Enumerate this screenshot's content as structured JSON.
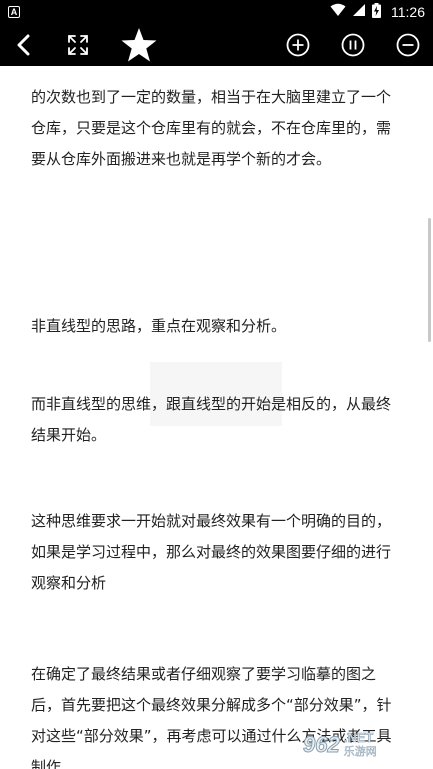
{
  "status_bar": {
    "notification_badge": "A",
    "time": "11:26",
    "icons": [
      "wifi-icon",
      "signal-icon",
      "battery-charging-icon"
    ]
  },
  "toolbar": {
    "buttons": [
      "back-arrow-icon",
      "fullscreen-icon",
      "star-icon",
      "zoom-in-icon",
      "pause-icon",
      "zoom-out-icon"
    ]
  },
  "content": {
    "paragraphs": [
      "的次数也到了一定的数量，相当于在大脑里建立了一个仓库，只要是这个仓库里有的就会，不在仓库里的，需要从仓库外面搬进来也就是再学个新的才会。",
      "非直线型的思路，重点在观察和分析。",
      "而非直线型的思维，跟直线型的开始是相反的，从最终结果开始。",
      "这种思维要求一开始就对最终效果有一个明确的目的，如果是学习过程中，那么对最终的效果图要仔细的进行观察和分析",
      "在确定了最终结果或者仔细观察了要学习临摹的图之后，首先要把这个最终效果分解成多个“部分效果”，针对这些“部分效果”，再考虑可以通过什么方法或者工具制作"
    ]
  },
  "watermark": {
    "logo": "962",
    "net": ".NET",
    "cn": "乐游网"
  },
  "colors": {
    "bar_bg": "#000000",
    "text": "#222222",
    "page_bg": "#ffffff"
  }
}
